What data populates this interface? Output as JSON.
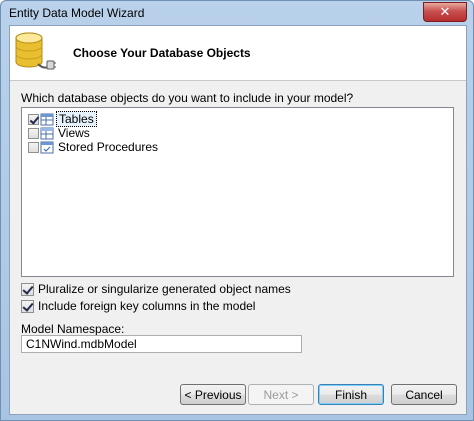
{
  "window": {
    "title": "Entity Data Model Wizard",
    "close_label": "✕"
  },
  "header": {
    "heading": "Choose Your Database Objects",
    "icon": "database-icon"
  },
  "prompt": "Which database objects do you want to include in your model?",
  "tree": {
    "items": [
      {
        "label": "Tables",
        "checked": true,
        "selected": true,
        "icon": "table-icon"
      },
      {
        "label": "Views",
        "checked": false,
        "selected": false,
        "icon": "view-icon"
      },
      {
        "label": "Stored Procedures",
        "checked": false,
        "selected": false,
        "icon": "stored-procedure-icon"
      }
    ]
  },
  "options": {
    "pluralize": {
      "label": "Pluralize or singularize generated object names",
      "checked": true
    },
    "foreign_keys": {
      "label": "Include foreign key columns in the model",
      "checked": true
    }
  },
  "namespace": {
    "label": "Model Namespace:",
    "value": "C1NWind.mdbModel"
  },
  "buttons": {
    "previous": "< Previous",
    "next": "Next >",
    "finish": "Finish",
    "cancel": "Cancel"
  },
  "colors": {
    "accent": "#3c7fb1",
    "titlebar": "#b9d1ea",
    "close": "#c75050"
  }
}
